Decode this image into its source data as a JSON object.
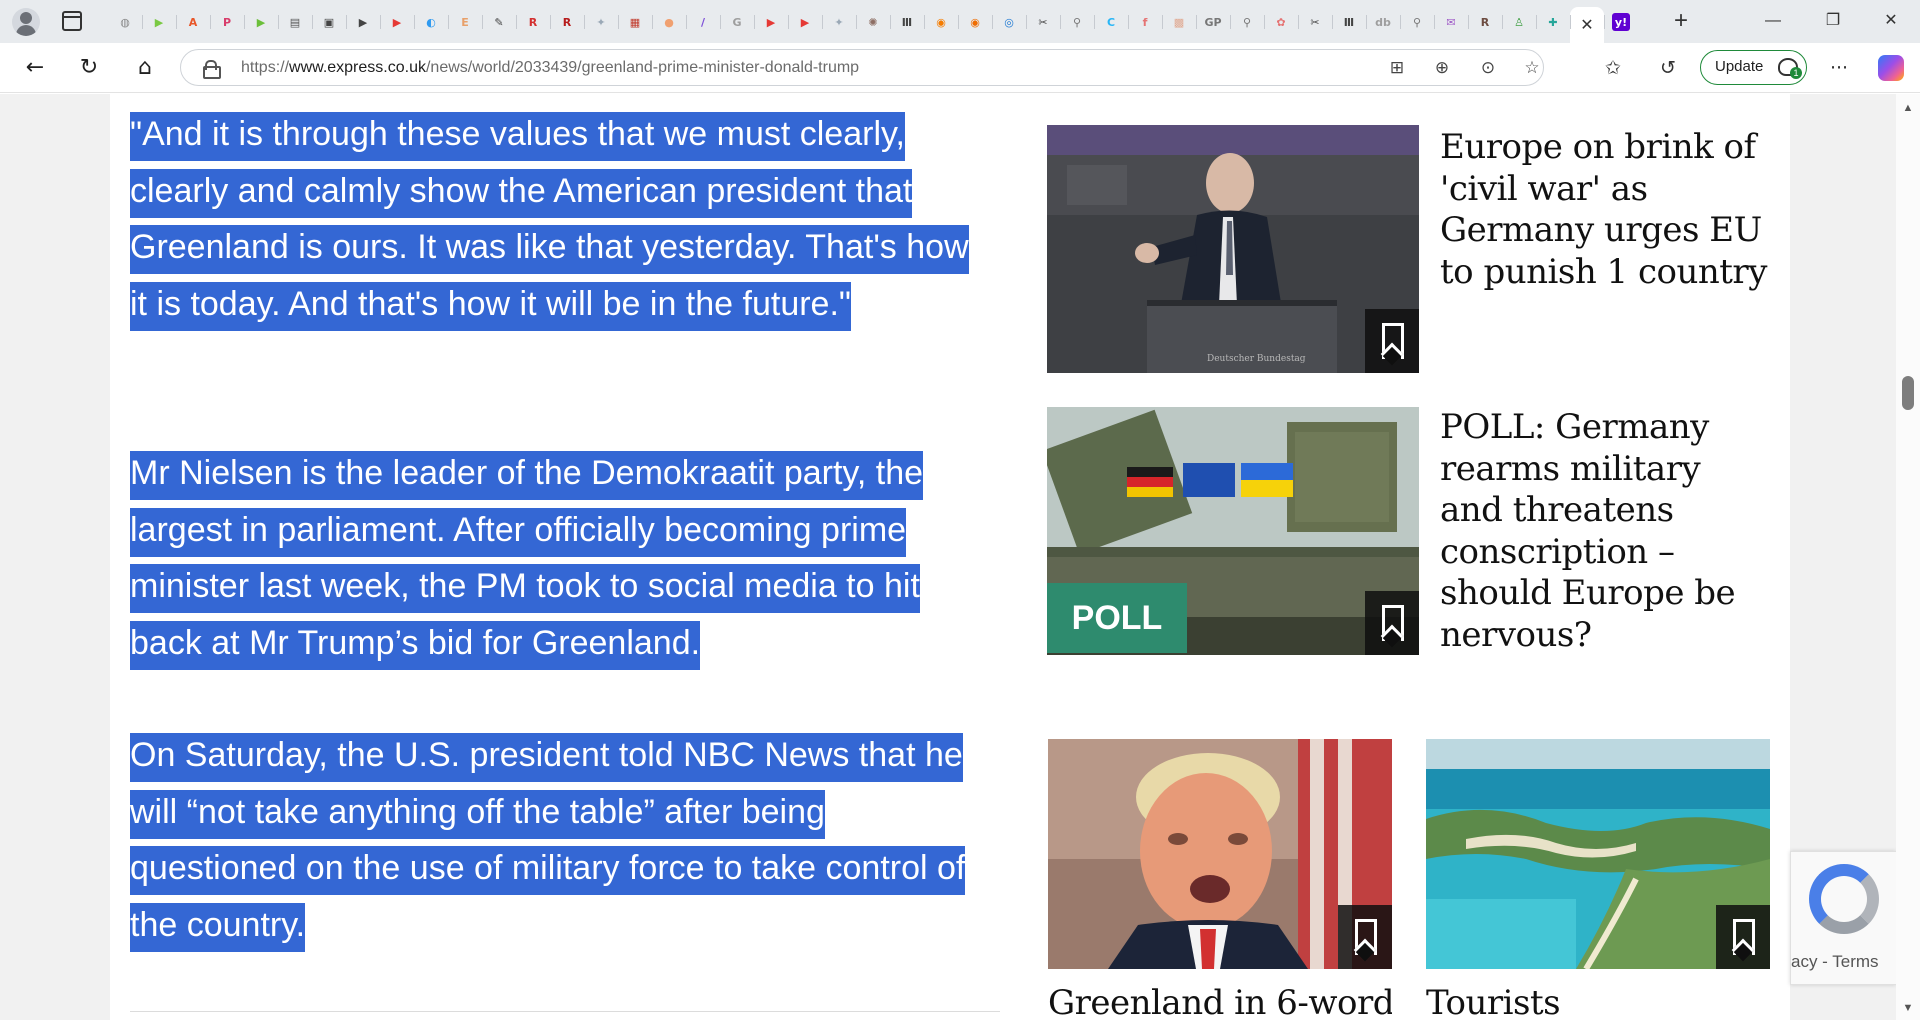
{
  "browser": {
    "tabs": [
      {
        "name": "globe",
        "glyph": "◍",
        "color": "#888888"
      },
      {
        "name": "play",
        "glyph": "▶",
        "color": "#7ac943"
      },
      {
        "name": "a",
        "glyph": "A",
        "color": "#e8572a"
      },
      {
        "name": "p",
        "glyph": "P",
        "color": "#d83d6b"
      },
      {
        "name": "play2",
        "glyph": "▶",
        "color": "#6bbf3a"
      },
      {
        "name": "news",
        "glyph": "▤",
        "color": "#555555"
      },
      {
        "name": "doc",
        "glyph": "▣",
        "color": "#444444"
      },
      {
        "name": "vid",
        "glyph": "▶",
        "color": "#444444"
      },
      {
        "name": "yt",
        "glyph": "▶",
        "color": "#e53935"
      },
      {
        "name": "edge",
        "glyph": "◐",
        "color": "#2f9af0"
      },
      {
        "name": "e",
        "glyph": "E",
        "color": "#e8a06a"
      },
      {
        "name": "pen",
        "glyph": "✎",
        "color": "#444444"
      },
      {
        "name": "r1",
        "glyph": "R",
        "color": "#d32f2f"
      },
      {
        "name": "r2",
        "glyph": "R",
        "color": "#b71c1c"
      },
      {
        "name": "map",
        "glyph": "✦",
        "color": "#9aa8b6"
      },
      {
        "name": "cal",
        "glyph": "▦",
        "color": "#c0392b"
      },
      {
        "name": "circle",
        "glyph": "●",
        "color": "#f0a070"
      },
      {
        "name": "feather",
        "glyph": "/",
        "color": "#7b4dd8"
      },
      {
        "name": "g",
        "glyph": "G",
        "color": "#9e9e9e"
      },
      {
        "name": "yt2",
        "glyph": "▶",
        "color": "#e53935"
      },
      {
        "name": "yt3",
        "glyph": "▶",
        "color": "#e53935"
      },
      {
        "name": "map2",
        "glyph": "✦",
        "color": "#9aa8b6"
      },
      {
        "name": "seal",
        "glyph": "✺",
        "color": "#8d6e63"
      },
      {
        "name": "bars",
        "glyph": "Ⅲ",
        "color": "#444444"
      },
      {
        "name": "rss1",
        "glyph": "◉",
        "color": "#f57c00"
      },
      {
        "name": "rss2",
        "glyph": "◉",
        "color": "#ef6c00"
      },
      {
        "name": "ring",
        "glyph": "◎",
        "color": "#1976d2"
      },
      {
        "name": "tool",
        "glyph": "✂",
        "color": "#444444"
      },
      {
        "name": "search1",
        "glyph": "⚲",
        "color": "#777777"
      },
      {
        "name": "c",
        "glyph": "C",
        "color": "#29b6f6"
      },
      {
        "name": "f",
        "glyph": "f",
        "color": "#e57373"
      },
      {
        "name": "grid",
        "glyph": "▩",
        "color": "#e0a890"
      },
      {
        "name": "gp",
        "glyph": "GP",
        "color": "#777777"
      },
      {
        "name": "search2",
        "glyph": "⚲",
        "color": "#777777"
      },
      {
        "name": "color",
        "glyph": "✿",
        "color": "#e57373"
      },
      {
        "name": "tool2",
        "glyph": "✂",
        "color": "#444444"
      },
      {
        "name": "bars2",
        "glyph": "Ⅲ",
        "color": "#444444"
      },
      {
        "name": "db",
        "glyph": "db",
        "color": "#9e9e9e"
      },
      {
        "name": "search3",
        "glyph": "⚲",
        "color": "#777777"
      },
      {
        "name": "mail",
        "glyph": "✉",
        "color": "#a05cc8"
      },
      {
        "name": "rk",
        "glyph": "R",
        "color": "#6d4c41"
      },
      {
        "name": "person",
        "glyph": "♙",
        "color": "#43a047"
      },
      {
        "name": "puzzle",
        "glyph": "✚",
        "color": "#26a69a"
      }
    ],
    "active_tab": {
      "glyph": "✕"
    },
    "extra_tab": {
      "glyph": "y!",
      "color": "#6001d2"
    },
    "new_tab_glyph": "+",
    "window": {
      "minimize": "—",
      "restore": "❐",
      "close": "✕"
    },
    "nav": {
      "back": "←",
      "reload": "↻",
      "home": "⌂"
    },
    "url": {
      "prefix": "https://",
      "host": "www.express.co.uk",
      "path": "/news/world/2033439/greenland-prime-minister-donald-trump"
    },
    "url_icons": {
      "apps": "⊞",
      "zoom": "⊕",
      "more_tools": "⊙",
      "favorite": "☆"
    },
    "toolbar_icons": {
      "favorites": "✩",
      "history": "↺",
      "menu": "···"
    },
    "update": {
      "label": "Update",
      "badge": "1"
    }
  },
  "article": {
    "paragraphs": [
      "\"And it is through these values that we must clearly, clearly and calmly show the American president that Greenland is ours. It was like that yesterday. That's how it is today. And that's how it will be in the future.\"",
      "Mr Nielsen is the leader of the Demokraatit party, the largest in parliament. After officially becoming prime minister last week, the PM took to social media to hit back at Mr Trump’s bid for Greenland.",
      "On Saturday, the U.S. president told NBC News that he will “not take anything off the table” after being questioned on the use of military force to take control of the country."
    ],
    "highlight_color": "#3467d4"
  },
  "sidebar": {
    "stories": [
      {
        "title": "Europe on brink of 'civil war' as Germany urges EU to punish 1 country"
      },
      {
        "title": "POLL: Germany rearms military and threatens conscription – should Europe be nervous?",
        "badge": "POLL"
      }
    ],
    "grid": [
      {
        "title": "Greenland in 6-word"
      },
      {
        "title": "Tourists"
      }
    ],
    "poll_color": "#2e8b6e"
  },
  "recaptcha": {
    "text": "acy - Terms"
  }
}
